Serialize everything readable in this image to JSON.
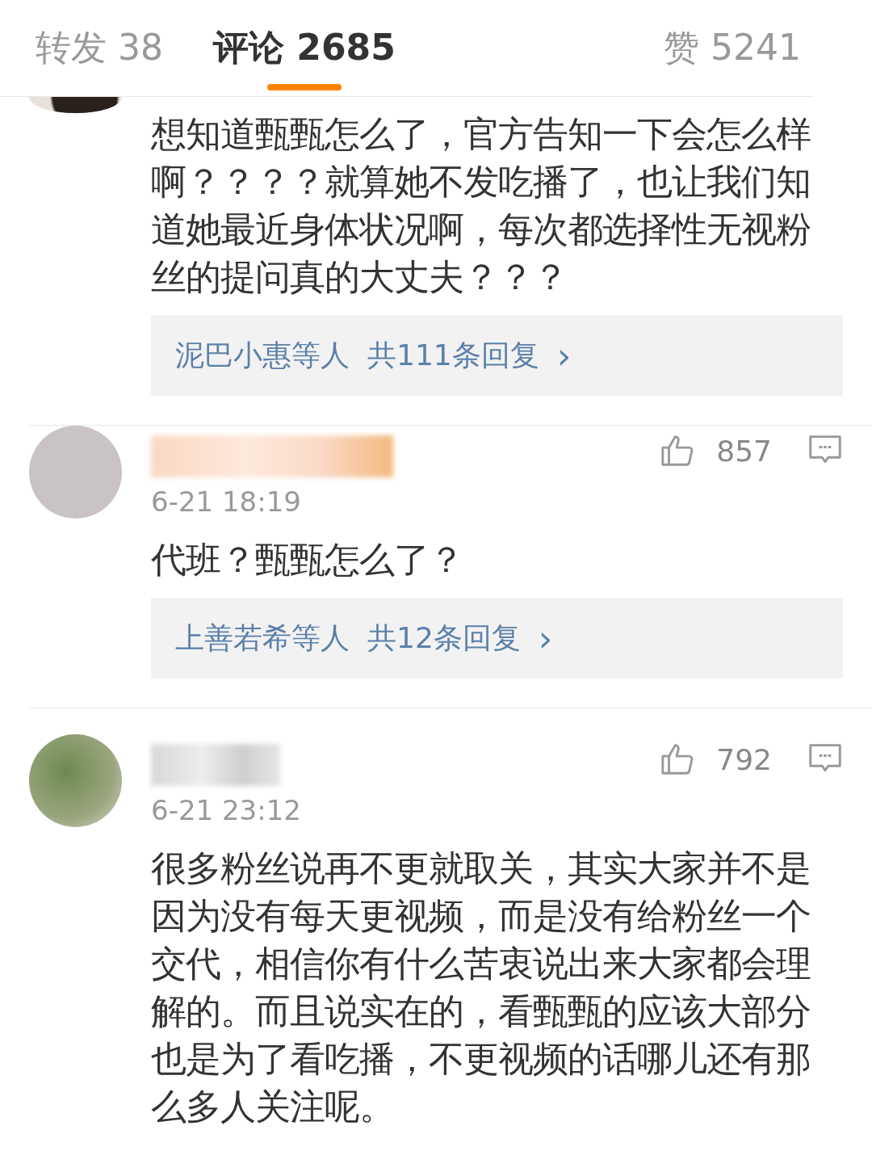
{
  "tabs": [
    {
      "label": "转发 38",
      "selected": false
    },
    {
      "label": "评论 2685",
      "selected": true
    },
    {
      "label": "赞 5241",
      "selected": false
    }
  ],
  "comments": [
    {
      "kind": "partial",
      "text": "想知道甄甄怎么了，官方告知一下会怎么样啊？？？？就算她不发吃播了，也让我们知道她最近身体状况啊，每次都选择性无视粉丝的提问真的大丈夫？？？",
      "replies": {
        "names": "泥巴小惠等人",
        "count": "共111条回复",
        "arrow": "›"
      }
    },
    {
      "kind": "full",
      "time": "6-21 18:19",
      "likes": "857",
      "text": "代班？甄甄怎么了？",
      "replies": {
        "names": "上善若希等人",
        "count": "共12条回复",
        "arrow": "›"
      }
    },
    {
      "kind": "full",
      "time": "6-21 23:12",
      "likes": "792",
      "text": "很多粉丝说再不更就取关，其实大家并不是因为没有每天更视频，而是没有给粉丝一个交代，相信你有什么苦衷说出来大家都会理解的。而且说实在的，看甄甄的应该大部分也是为了看吃播，不更视频的话哪儿还有那么多人关注呢。"
    }
  ]
}
